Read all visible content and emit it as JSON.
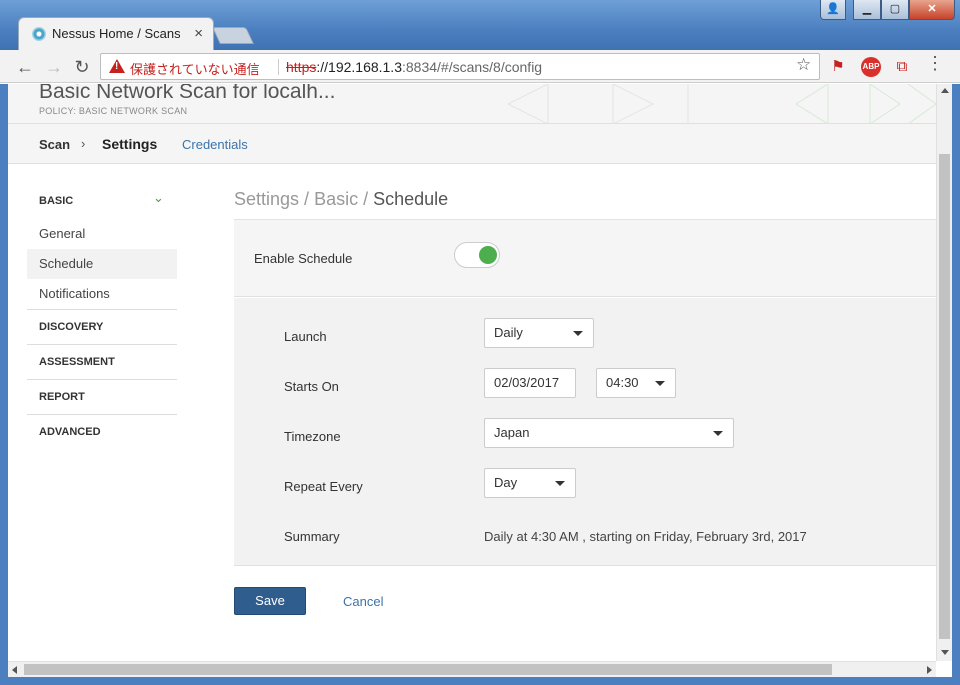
{
  "browser": {
    "tab_title": "Nessus Home / Scans",
    "security_label": "保護されていない通信",
    "url_scheme": "https",
    "url_host": "://192.168.1.3",
    "url_rest": ":8834/#/scans/8/config",
    "ext_abp": "ABP"
  },
  "header": {
    "title": "Basic Network Scan for localh...",
    "policy": "POLICY: BASIC NETWORK SCAN"
  },
  "subnav": {
    "scan": "Scan",
    "settings": "Settings",
    "credentials": "Credentials"
  },
  "sidebar": {
    "basic_label": "BASIC",
    "items": [
      {
        "label": "General"
      },
      {
        "label": "Schedule"
      },
      {
        "label": "Notifications"
      }
    ],
    "categories": [
      {
        "label": "DISCOVERY"
      },
      {
        "label": "ASSESSMENT"
      },
      {
        "label": "REPORT"
      },
      {
        "label": "ADVANCED"
      }
    ]
  },
  "breadcrumb": {
    "settings": "Settings",
    "sep1": " / ",
    "basic": "Basic",
    "sep2": " / ",
    "current": "Schedule"
  },
  "schedule": {
    "enable_label": "Enable Schedule",
    "enabled": true,
    "launch_label": "Launch",
    "launch_value": "Daily",
    "starts_label": "Starts On",
    "starts_date": "02/03/2017",
    "starts_time": "04:30",
    "timezone_label": "Timezone",
    "timezone_value": "Japan",
    "repeat_label": "Repeat Every",
    "repeat_value": "Day",
    "summary_label": "Summary",
    "summary_text": "Daily at 4:30 AM , starting on Friday, February 3rd, 2017"
  },
  "actions": {
    "save": "Save",
    "cancel": "Cancel"
  },
  "colors": {
    "accent": "#2f5e8e",
    "link": "#3c74a9",
    "toggle_on": "#4cae4c",
    "warning": "#c5221f"
  }
}
